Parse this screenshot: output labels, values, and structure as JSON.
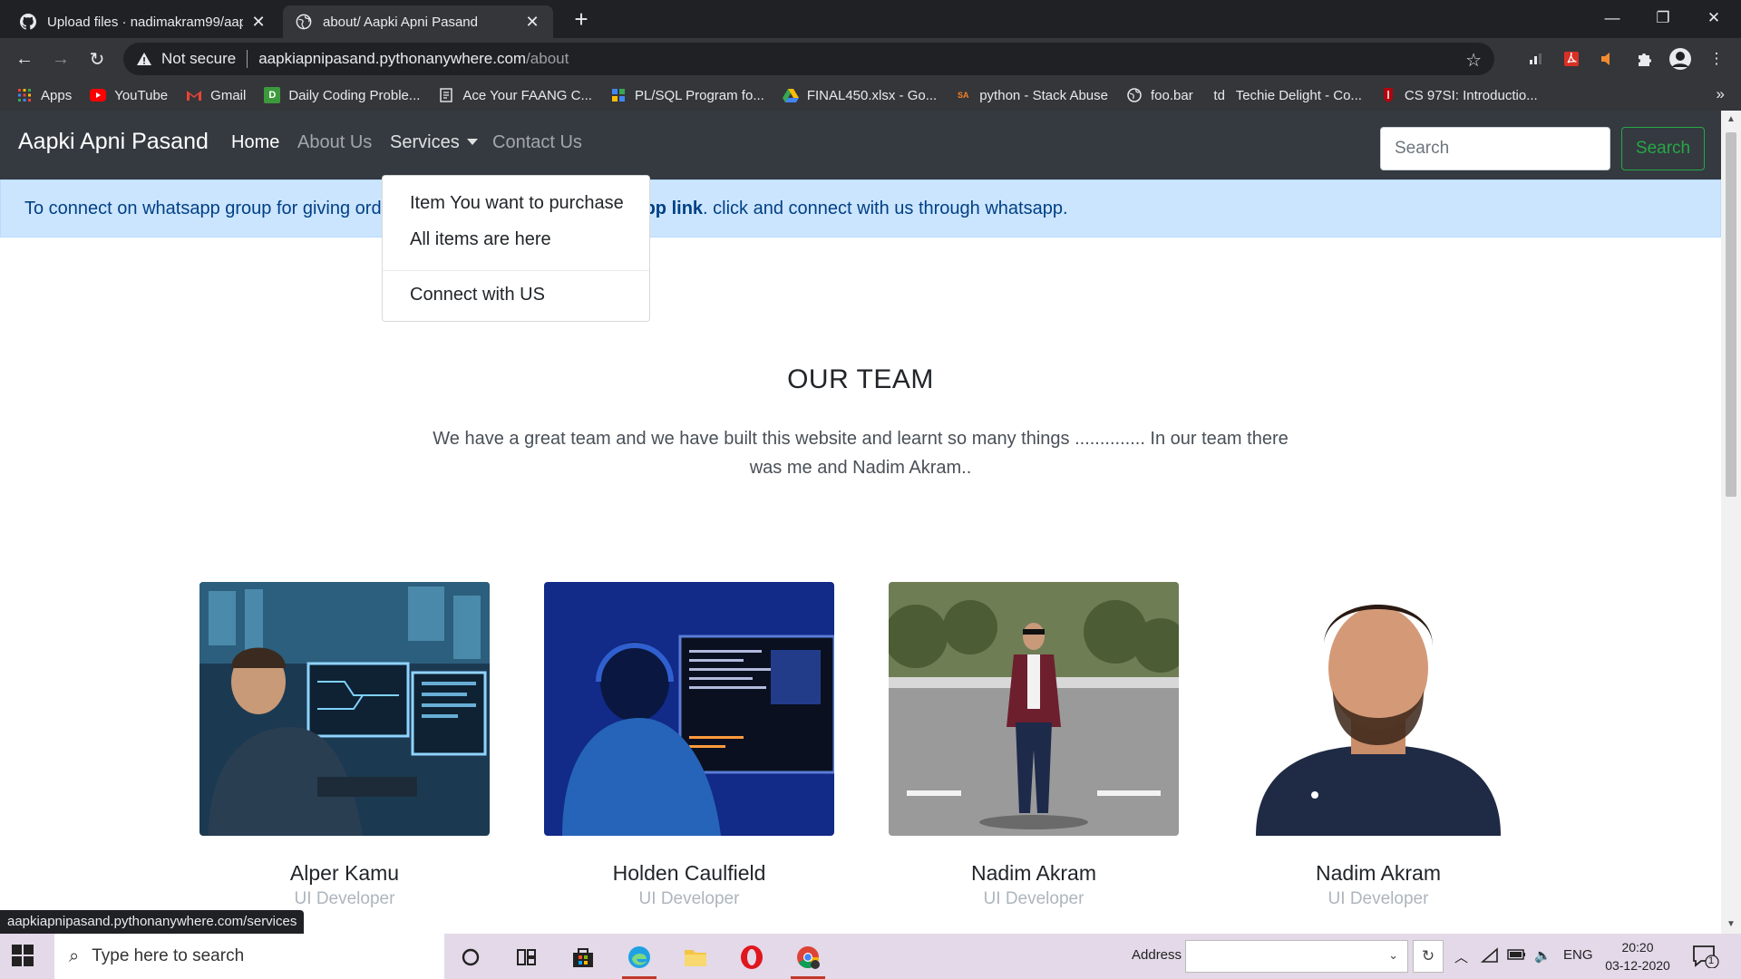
{
  "browser": {
    "tabs": [
      {
        "title": "Upload files · nadimakram99/aap",
        "active": false
      },
      {
        "title": "about/ Aapki Apni Pasand",
        "active": true
      }
    ],
    "new_tab": "+",
    "window_controls": {
      "minimize": "—",
      "restore": "❐",
      "close": "✕"
    },
    "omnibox": {
      "security": "Not secure",
      "host": "aapkiapnipasand.pythonanywhere.com",
      "path": "/about"
    },
    "bookmarks": [
      {
        "label": "Apps",
        "icon": "apps-grid-icon"
      },
      {
        "label": "YouTube",
        "icon": "youtube-icon"
      },
      {
        "label": "Gmail",
        "icon": "gmail-icon"
      },
      {
        "label": "Daily Coding Proble...",
        "icon": "daily-coding-icon"
      },
      {
        "label": "Ace Your FAANG C...",
        "icon": "page-icon"
      },
      {
        "label": "PL/SQL Program fo...",
        "icon": "plsql-icon"
      },
      {
        "label": "FINAL450.xlsx - Go...",
        "icon": "google-drive-icon"
      },
      {
        "label": "python - Stack Abuse",
        "icon": "stack-abuse-icon"
      },
      {
        "label": "foo.bar",
        "icon": "globe-icon"
      },
      {
        "label": "Techie Delight - Co...",
        "icon": "td-icon"
      },
      {
        "label": "CS 97SI: Introductio...",
        "icon": "stanford-icon"
      }
    ],
    "bookmarks_more": "»",
    "status_url": "aapkiapnipasand.pythonanywhere.com/services"
  },
  "site": {
    "brand": "Aapki Apni Pasand",
    "nav": {
      "home": "Home",
      "about": "About Us",
      "services": "Services",
      "contact": "Contact Us"
    },
    "search": {
      "placeholder": "Search",
      "button": "Search"
    },
    "alert": {
      "prefix": "To connect on whatsapp group for giving ord",
      "link_tail": "pp link",
      "suffix": ". click and connect with us through whatsapp."
    },
    "dropdown": {
      "items": [
        "Item You want to purchase",
        "All items are here"
      ],
      "after_divider": "Connect with US"
    },
    "team": {
      "title": "OUR TEAM",
      "description": "We have a great team and we have built this website and learnt so many things .............. In our team there was me and Nadim Akram..",
      "members": [
        {
          "name": "Alper Kamu",
          "role": "UI Developer",
          "photo": "developer-monitors-photo"
        },
        {
          "name": "Holden Caulfield",
          "role": "UI Developer",
          "photo": "developer-headset-photo"
        },
        {
          "name": "Nadim Akram",
          "role": "UI Developer",
          "photo": "man-on-road-photo"
        },
        {
          "name": "Nadim Akram",
          "role": "UI Developer",
          "photo": "portrait-photo"
        }
      ]
    }
  },
  "taskbar": {
    "search_placeholder": "Type here to search",
    "address_label": "Address",
    "language": "ENG",
    "time": "20:20",
    "date": "03-12-2020",
    "notification_count": "1"
  },
  "colors": {
    "navbar": "#343a40",
    "alert_bg": "#cce5ff",
    "search_button": "#28a745"
  }
}
